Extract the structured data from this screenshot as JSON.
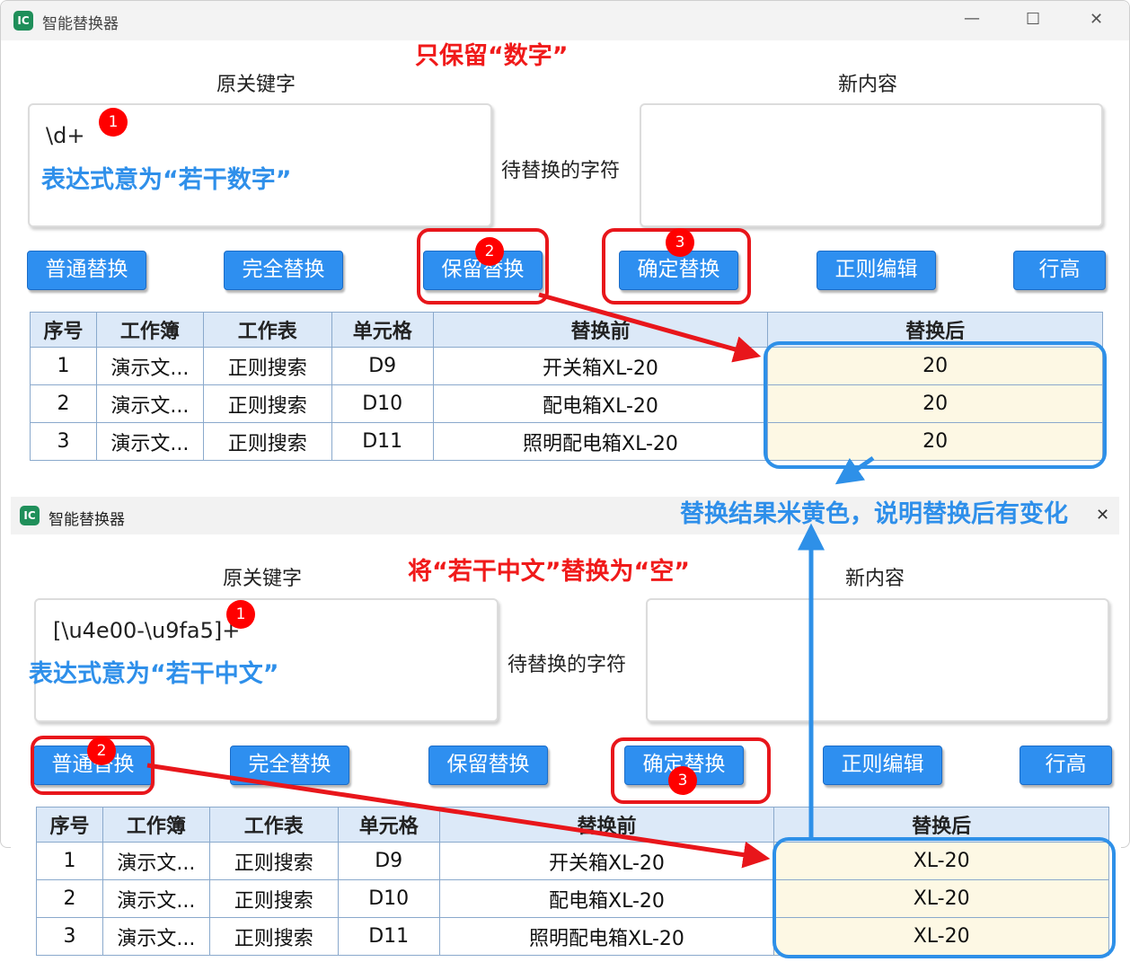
{
  "top": {
    "title": "智能替换器",
    "window_controls": {
      "min": "—",
      "max": "☐",
      "close": "✕"
    },
    "labels": {
      "original": "原关键字",
      "middle": "待替换的字符",
      "new": "新内容"
    },
    "original_value": "\\d+",
    "new_value": "",
    "buttons": [
      "普通替换",
      "完全替换",
      "保留替换",
      "确定替换",
      "正则编辑",
      "行高"
    ],
    "table": {
      "headers": [
        "序号",
        "工作簿",
        "工作表",
        "单元格",
        "替换前",
        "替换后"
      ],
      "rows": [
        [
          "1",
          "演示文...",
          "正则搜索",
          "D9",
          "开关箱XL-20",
          "20"
        ],
        [
          "2",
          "演示文...",
          "正则搜索",
          "D10",
          "配电箱XL-20",
          "20"
        ],
        [
          "3",
          "演示文...",
          "正则搜索",
          "D11",
          "照明配电箱XL-20",
          "20"
        ]
      ]
    },
    "annotations": {
      "heading": "只保留“数字”",
      "expr_note": "表达式意为“若干数字”"
    },
    "badges": [
      "1",
      "2",
      "3"
    ]
  },
  "bottom": {
    "title": "智能替换器",
    "window_controls": {
      "close": "✕"
    },
    "labels": {
      "original": "原关键字",
      "middle": "待替换的字符",
      "new": "新内容"
    },
    "original_value": "[\\u4e00-\\u9fa5]+",
    "new_value": "",
    "buttons": [
      "普通替换",
      "完全替换",
      "保留替换",
      "确定替换",
      "正则编辑",
      "行高"
    ],
    "table": {
      "headers": [
        "序号",
        "工作簿",
        "工作表",
        "单元格",
        "替换前",
        "替换后"
      ],
      "rows": [
        [
          "1",
          "演示文...",
          "正则搜索",
          "D9",
          "开关箱XL-20",
          "XL-20"
        ],
        [
          "2",
          "演示文...",
          "正则搜索",
          "D10",
          "配电箱XL-20",
          "XL-20"
        ],
        [
          "3",
          "演示文...",
          "正则搜索",
          "D11",
          "照明配电箱XL-20",
          "XL-20"
        ]
      ]
    },
    "annotations": {
      "heading": "将“若干中文”替换为“空”",
      "expr_note": "表达式意为“若干中文”"
    },
    "badges": [
      "1",
      "2",
      "3"
    ]
  },
  "middle_note": "替换结果米黄色，说明替换后有变化",
  "colors": {
    "button": "#2e8ff0",
    "header": "#dce9f8",
    "changed_cell": "#fdf8e4",
    "red_note": "#f01a1a",
    "blue_note": "#2e8fea"
  }
}
